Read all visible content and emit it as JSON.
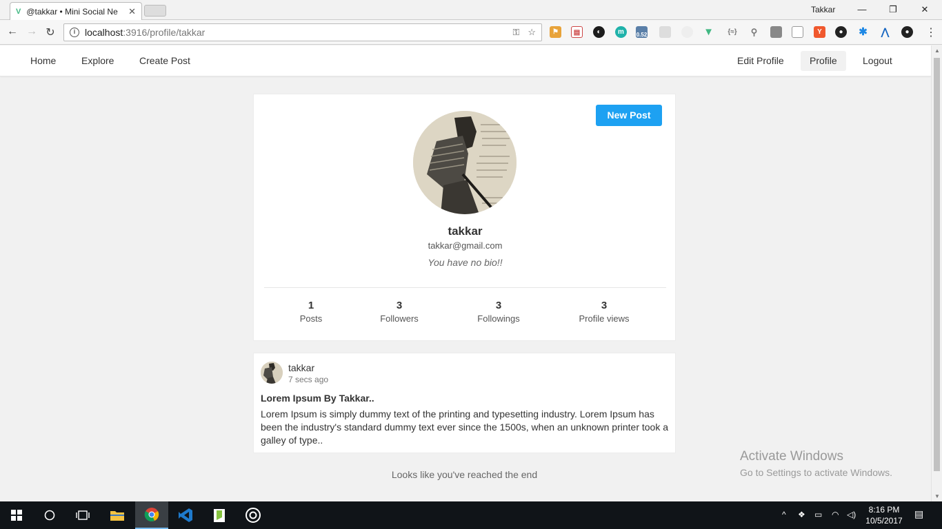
{
  "browser": {
    "tab_title": "@takkar • Mini Social Ne",
    "tab_favicon": "V",
    "profile_name": "Takkar",
    "url_host": "localhost",
    "url_path": ":3916/profile/takkar",
    "ext_badge": "0.52",
    "ext_brackets": "{≈}"
  },
  "nav": {
    "home": "Home",
    "explore": "Explore",
    "create_post": "Create Post",
    "edit_profile": "Edit Profile",
    "profile": "Profile",
    "logout": "Logout"
  },
  "profile": {
    "new_post_label": "New Post",
    "username": "takkar",
    "email": "takkar@gmail.com",
    "bio": "You have no bio!!",
    "stats": [
      {
        "value": "1",
        "label": "Posts"
      },
      {
        "value": "3",
        "label": "Followers"
      },
      {
        "value": "3",
        "label": "Followings"
      },
      {
        "value": "3",
        "label": "Profile views"
      }
    ]
  },
  "post": {
    "author": "takkar",
    "time": "7 secs ago",
    "title": "Lorem Ipsum By Takkar..",
    "body": "Lorem Ipsum is simply dummy text of the printing and typesetting industry. Lorem Ipsum has been the industry's standard dummy text ever since the 1500s, when an unknown printer took a galley of type.."
  },
  "end_message": "Looks like you've reached the end",
  "watermark": {
    "title": "Activate Windows",
    "subtitle": "Go to Settings to activate Windows."
  },
  "taskbar": {
    "time": "8:16 PM",
    "date": "10/5/2017"
  },
  "colors": {
    "accent": "#1da1f2",
    "page_bg": "#f1f1f1",
    "taskbar": "#101418"
  }
}
